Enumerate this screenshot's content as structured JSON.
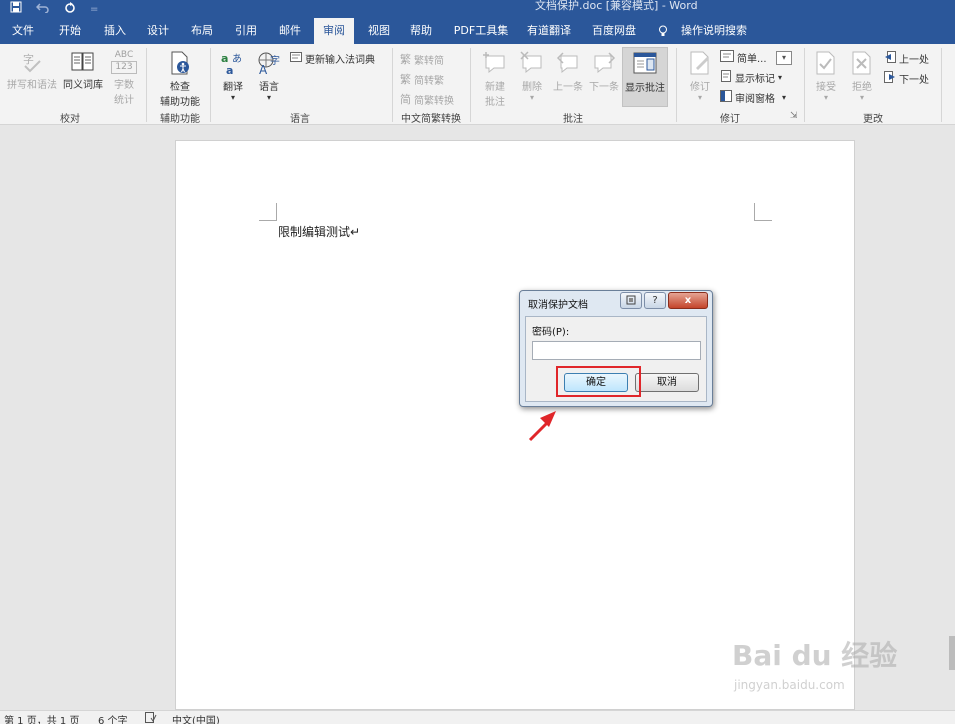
{
  "window": {
    "title": "文档保护.doc [兼容模式] - Word",
    "qat": {
      "save_icon": "save-icon",
      "undo_icon": "undo-icon",
      "redo_icon": "redo-icon",
      "customize_icon": "customize-icon"
    }
  },
  "tabs": [
    {
      "label": "文件",
      "active": false
    },
    {
      "label": "开始",
      "active": false
    },
    {
      "label": "插入",
      "active": false
    },
    {
      "label": "设计",
      "active": false
    },
    {
      "label": "布局",
      "active": false
    },
    {
      "label": "引用",
      "active": false
    },
    {
      "label": "邮件",
      "active": false
    },
    {
      "label": "审阅",
      "active": true
    },
    {
      "label": "视图",
      "active": false
    },
    {
      "label": "帮助",
      "active": false
    },
    {
      "label": "PDF工具集",
      "active": false
    },
    {
      "label": "有道翻译",
      "active": false
    },
    {
      "label": "百度网盘",
      "active": false
    },
    {
      "label": "操作说明搜索",
      "active": false
    }
  ],
  "ribbon": {
    "proofing": {
      "label": "校对",
      "spelling": "拼写和语法",
      "thesaurus": "同义词库",
      "wordcount_line1": "字数",
      "wordcount_line2": "统计",
      "abc_text": "ABC",
      "num_text": "123"
    },
    "accessibility": {
      "label": "辅助功能",
      "check_line1": "检查",
      "check_line2": "辅助功能"
    },
    "language": {
      "label": "语言",
      "translate": "翻译",
      "language": "语言",
      "update_ime": "更新输入法词典"
    },
    "chinese_conversion": {
      "label": "中文简繁转换",
      "to_simplified": "繁转简",
      "to_traditional": "简转繁",
      "convert": "简繁转换"
    },
    "comments": {
      "label": "批注",
      "new_line1": "新建",
      "new_line2": "批注",
      "delete": "删除",
      "previous": "上一条",
      "next": "下一条",
      "show": "显示批注"
    },
    "tracking": {
      "label": "修订",
      "track": "修订",
      "display_mode": "简单...",
      "show_markup": "显示标记",
      "reviewing_pane": "审阅窗格"
    },
    "changes": {
      "label": "更改",
      "accept": "接受",
      "reject": "拒绝",
      "previous": "上一处",
      "next": "下一处"
    }
  },
  "document": {
    "text": "限制编辑测试↵"
  },
  "dialog": {
    "title": "取消保护文档",
    "password_label": "密码(P):",
    "password_value": "",
    "ok_label": "确定",
    "cancel_label": "取消",
    "help_glyph": "?",
    "close_glyph": "x"
  },
  "annotation": {
    "highlight_color": "#e0262a"
  },
  "statusbar": {
    "page": "第 1 页，共 1 页",
    "words": "6 个字",
    "language": "中文(中国)"
  },
  "watermark": {
    "brand": "Bai du 经验",
    "url": "jingyan.baidu.com"
  },
  "colors": {
    "titlebar": "#2b579a",
    "ribbon_bg": "#f3f3f3",
    "workspace_bg": "#e6e6e6"
  }
}
